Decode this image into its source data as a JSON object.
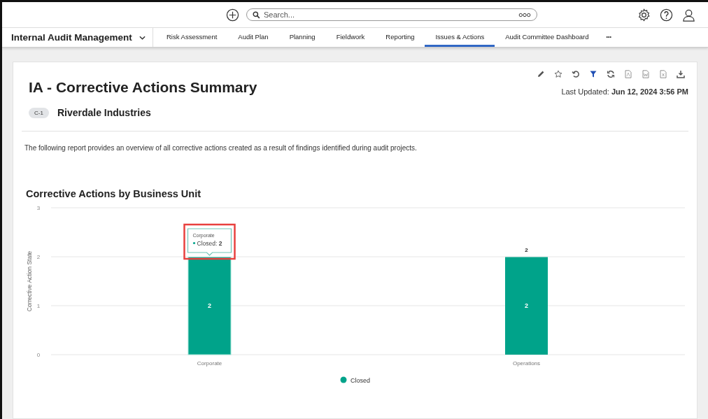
{
  "header": {
    "search": {
      "placeholder": "Search..."
    }
  },
  "nav": {
    "app_name": "Internal Audit Management",
    "tabs": [
      {
        "label": "Risk Assessment",
        "selected": false
      },
      {
        "label": "Audit Plan",
        "selected": false
      },
      {
        "label": "Planning",
        "selected": false
      },
      {
        "label": "Fieldwork",
        "selected": false
      },
      {
        "label": "Reporting",
        "selected": false
      },
      {
        "label": "Issues & Actions",
        "selected": true
      },
      {
        "label": "Audit Committee Dashboard",
        "selected": false
      }
    ],
    "more": "•••"
  },
  "report": {
    "title": "IA - Corrective Actions Summary",
    "last_updated_label": "Last Updated:",
    "last_updated": "Jun 12, 2024 3:56 PM",
    "tag": "C-1",
    "entity": "Riverdale Industries",
    "description": "The following report provides an overview of all corrective actions created as a result of findings identified during audit projects.",
    "chart": {
      "tooltip": {
        "category": "Corporate",
        "series": "Closed:",
        "value": "2",
        "highlighted": true
      },
      "hovered": [
        true,
        false
      ],
      "inside_labels": [
        "2",
        "2"
      ],
      "chart_data": {
        "type": "bar",
        "title": "Corrective Actions by Business Unit",
        "ylabel": "Corrective Action State",
        "categories": [
          "Corporate",
          "Operations"
        ],
        "series": [
          {
            "name": "Closed",
            "color": "#00a38a",
            "values": [
              2,
              2
            ]
          }
        ],
        "ylim": [
          0,
          3
        ],
        "yticks": [
          0,
          1,
          2,
          3
        ],
        "data_labels": true
      }
    }
  }
}
